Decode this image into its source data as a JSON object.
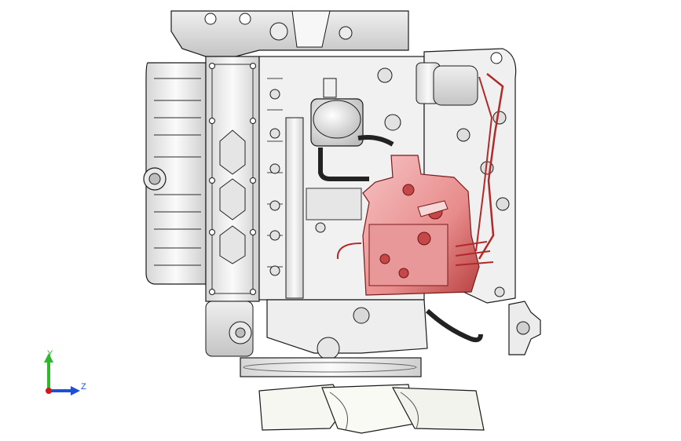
{
  "triad": {
    "y_label": "Y",
    "z_label": "Z",
    "y_color": "#2db82d",
    "z_color": "#1d4fd8",
    "x_color": "#d01818"
  },
  "colors": {
    "background": "#ffffff",
    "metal_fill": "#f3f3f3",
    "metal_shade": "#c9c9c9",
    "outline": "#1a1a1a",
    "pump_fill": "#f0a8a8",
    "pump_dark": "#c23c3c",
    "fan_fill": "#f7f7f2"
  },
  "components": {
    "engine_block": "engine-block",
    "oil_pan": "oil-pan",
    "valve_cover": "valve-cover",
    "oil_filter": "oil-filter",
    "injection_pump": "fuel-injection-pump",
    "thermostat_housing": "thermostat-housing",
    "fan": "cooling-fan",
    "pulley": "crank-pulley"
  }
}
